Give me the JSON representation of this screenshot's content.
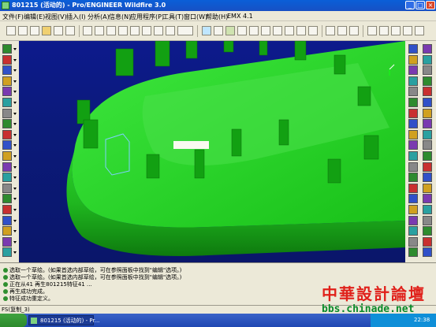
{
  "window": {
    "title": "801215 (活动的) - Pro/ENGINEER Wildfire 3.0",
    "controls": [
      "minimize",
      "maximize",
      "close"
    ]
  },
  "menu": [
    "文件(F)",
    "编辑(E)",
    "视图(V)",
    "插入(I)",
    "分析(A)",
    "信息(N)",
    "应用程序(P)",
    "工具(T)",
    "窗口(W)",
    "帮助(H)",
    "EMX 4.1"
  ],
  "messages": [
    {
      "text": "选取一个草绘。(如果首选内部草绘，可在参照面板中找到\"编辑\"选项。)",
      "color": "#2f8f2f"
    },
    {
      "text": "选取一个草绘。(如果首选内部草绘，可在参照面板中找到\"编辑\"选项。)",
      "color": "#2f8f2f"
    },
    {
      "text": "正在从41 再生801215特征41 ...",
      "color": "#2f8f2f"
    },
    {
      "text": "再生成功完成。",
      "color": "#2f8f2f"
    },
    {
      "text": "特征成功重定义。",
      "color": "#2f8f2f"
    }
  ],
  "status_text": "FS(复制_3)",
  "taskbar": {
    "task_label": "801215 (活动的) - Pr...",
    "clock": "22:38"
  },
  "watermark": {
    "title": "中華設計論壇",
    "url": "bbs.chinade.net"
  },
  "colors": {
    "viewport_bg": "#0b1a7a",
    "model_green": "#1fd41f",
    "titlebar": "#0a5fd8"
  }
}
